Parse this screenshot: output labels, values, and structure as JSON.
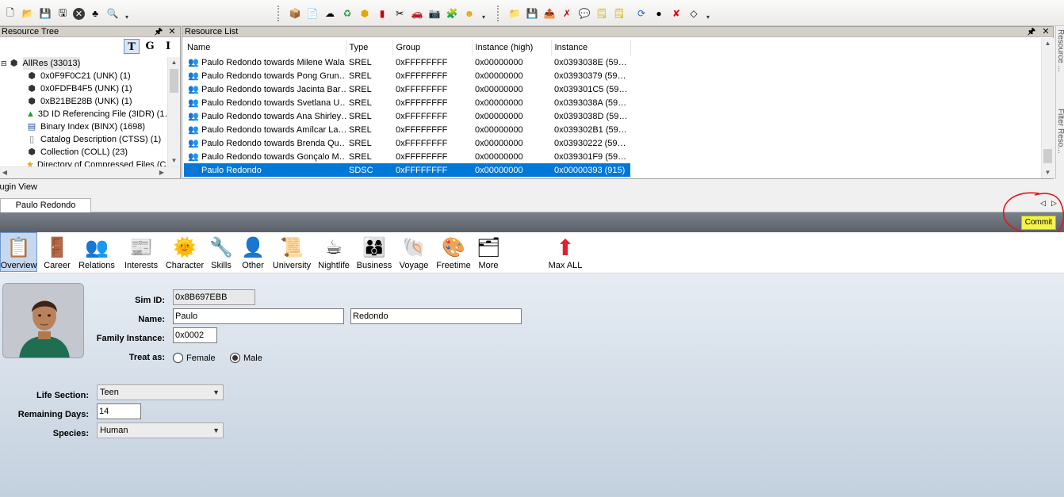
{
  "toolbar": {
    "group1_icons": [
      "new-icon",
      "open-icon",
      "save-icon",
      "save-as-icon",
      "close-icon",
      "sims-icon",
      "search-icon"
    ],
    "group2_icons": [
      "package-icon",
      "document-icon",
      "cloud-icon",
      "recycle-icon",
      "star-icon",
      "battery-icon",
      "tools-icon",
      "car-icon",
      "camera-icon",
      "puzzle-icon",
      "person-icon"
    ],
    "group3_icons": [
      "folder-edit-icon",
      "save-file-icon",
      "export-icon",
      "delete-file-icon",
      "comment-icon",
      "note-icon",
      "note-alt-icon",
      "refresh-icon",
      "bomb-icon",
      "red-x-icon",
      "eraser-icon"
    ]
  },
  "resource_tree": {
    "title": "Resource Tree",
    "toggle_buttons": [
      "T",
      "G",
      "I"
    ],
    "items": [
      {
        "label": "AllRes (33013)",
        "icon": "cube-icon",
        "level": 0,
        "expander": "⊟"
      },
      {
        "label": "0x0F9F0C21 (UNK) (1)",
        "icon": "cube-icon",
        "level": 1
      },
      {
        "label": "0x0FDFB4F5 (UNK) (1)",
        "icon": "cube-icon",
        "level": 1
      },
      {
        "label": "0xB21BE28B (UNK) (1)",
        "icon": "cube-icon",
        "level": 1
      },
      {
        "label": "3D ID Referencing File (3IDR) (1…",
        "icon": "3d-icon",
        "level": 1
      },
      {
        "label": "Binary Index (BINX) (1698)",
        "icon": "binary-icon",
        "level": 1
      },
      {
        "label": "Catalog Description (CTSS) (1)",
        "icon": "page-icon",
        "level": 1
      },
      {
        "label": "Collection (COLL) (23)",
        "icon": "cube-icon",
        "level": 1
      },
      {
        "label": "Directory of Compressed Files (C…",
        "icon": "folder-star-icon",
        "level": 1
      }
    ]
  },
  "resource_list": {
    "title": "Resource List",
    "columns": [
      "Name",
      "Type",
      "Group",
      "Instance (high)",
      "Instance"
    ],
    "rows": [
      {
        "name": "Paulo Redondo towards Milene Wala",
        "type": "SREL",
        "group": "0xFFFFFFFF",
        "inst_high": "0x00000000",
        "instance": "0x0393038E (59…",
        "selected": false
      },
      {
        "name": "Paulo Redondo towards Pong Grun…",
        "type": "SREL",
        "group": "0xFFFFFFFF",
        "inst_high": "0x00000000",
        "instance": "0x03930379 (59…",
        "selected": false
      },
      {
        "name": "Paulo Redondo towards Jacinta Bar…",
        "type": "SREL",
        "group": "0xFFFFFFFF",
        "inst_high": "0x00000000",
        "instance": "0x039301C5 (59…",
        "selected": false
      },
      {
        "name": "Paulo Redondo towards Svetlana U…",
        "type": "SREL",
        "group": "0xFFFFFFFF",
        "inst_high": "0x00000000",
        "instance": "0x0393038A (59…",
        "selected": false
      },
      {
        "name": "Paulo Redondo towards Ana Shirley…",
        "type": "SREL",
        "group": "0xFFFFFFFF",
        "inst_high": "0x00000000",
        "instance": "0x0393038D (59…",
        "selected": false
      },
      {
        "name": "Paulo Redondo towards Amílcar La…",
        "type": "SREL",
        "group": "0xFFFFFFFF",
        "inst_high": "0x00000000",
        "instance": "0x039302B1 (59…",
        "selected": false
      },
      {
        "name": "Paulo Redondo towards Brenda Qu…",
        "type": "SREL",
        "group": "0xFFFFFFFF",
        "inst_high": "0x00000000",
        "instance": "0x03930222 (59…",
        "selected": false
      },
      {
        "name": "Paulo Redondo towards Gonçalo M…",
        "type": "SREL",
        "group": "0xFFFFFFFF",
        "inst_high": "0x00000000",
        "instance": "0x039301F9 (59…",
        "selected": false
      },
      {
        "name": "Paulo Redondo",
        "type": "SDSC",
        "group": "0xFFFFFFFF",
        "inst_high": "0x00000000",
        "instance": "0x00000393 (915)",
        "selected": true
      }
    ]
  },
  "side_tabs": [
    "Resource ...",
    "Filter Reso..."
  ],
  "plugin": {
    "label": "lugin View",
    "tab": "Paulo Redondo",
    "commit_label": "Commit"
  },
  "sim_toolbar": [
    {
      "label": "Overview",
      "icon": "overview-icon",
      "glyph": "📋",
      "active": true
    },
    {
      "label": "Career",
      "icon": "career-icon",
      "glyph": "🚪"
    },
    {
      "label": "Relations",
      "icon": "relations-icon",
      "glyph": "👥"
    },
    {
      "label": "Interests",
      "icon": "interests-icon",
      "glyph": "📰"
    },
    {
      "label": "Character",
      "icon": "character-icon",
      "glyph": "🌞"
    },
    {
      "label": "Skills",
      "icon": "skills-icon",
      "glyph": "🔧"
    },
    {
      "label": "Other",
      "icon": "other-icon",
      "glyph": "👤"
    },
    {
      "label": "University",
      "icon": "university-icon",
      "glyph": "📜"
    },
    {
      "label": "Nightlife",
      "icon": "nightlife-icon",
      "glyph": "☕"
    },
    {
      "label": "Business",
      "icon": "business-icon",
      "glyph": "👨‍👩‍👦"
    },
    {
      "label": "Voyage",
      "icon": "voyage-icon",
      "glyph": "🐚"
    },
    {
      "label": "Freetime",
      "icon": "freetime-icon",
      "glyph": "🎨"
    },
    {
      "label": "More",
      "icon": "more-icon",
      "glyph": "🗂"
    },
    {
      "label": "Max ALL",
      "icon": "max-all-icon",
      "glyph": "⬆"
    }
  ],
  "form": {
    "sim_id_label": "Sim ID:",
    "sim_id": "0x8B697EBB",
    "name_label": "Name:",
    "first_name": "Paulo",
    "last_name": "Redondo",
    "family_label": "Family Instance:",
    "family_instance": "0x0002",
    "treat_label": "Treat as:",
    "female_label": "Female",
    "male_label": "Male",
    "treat_as": "Male",
    "life_section_label": "Life Section:",
    "life_section": "Teen",
    "remaining_days_label": "Remaining Days:",
    "remaining_days": "14",
    "species_label": "Species:",
    "species": "Human"
  },
  "colors": {
    "selection": "#0078d7",
    "commit": "#f3f34a",
    "annotation": "#e0161b"
  }
}
